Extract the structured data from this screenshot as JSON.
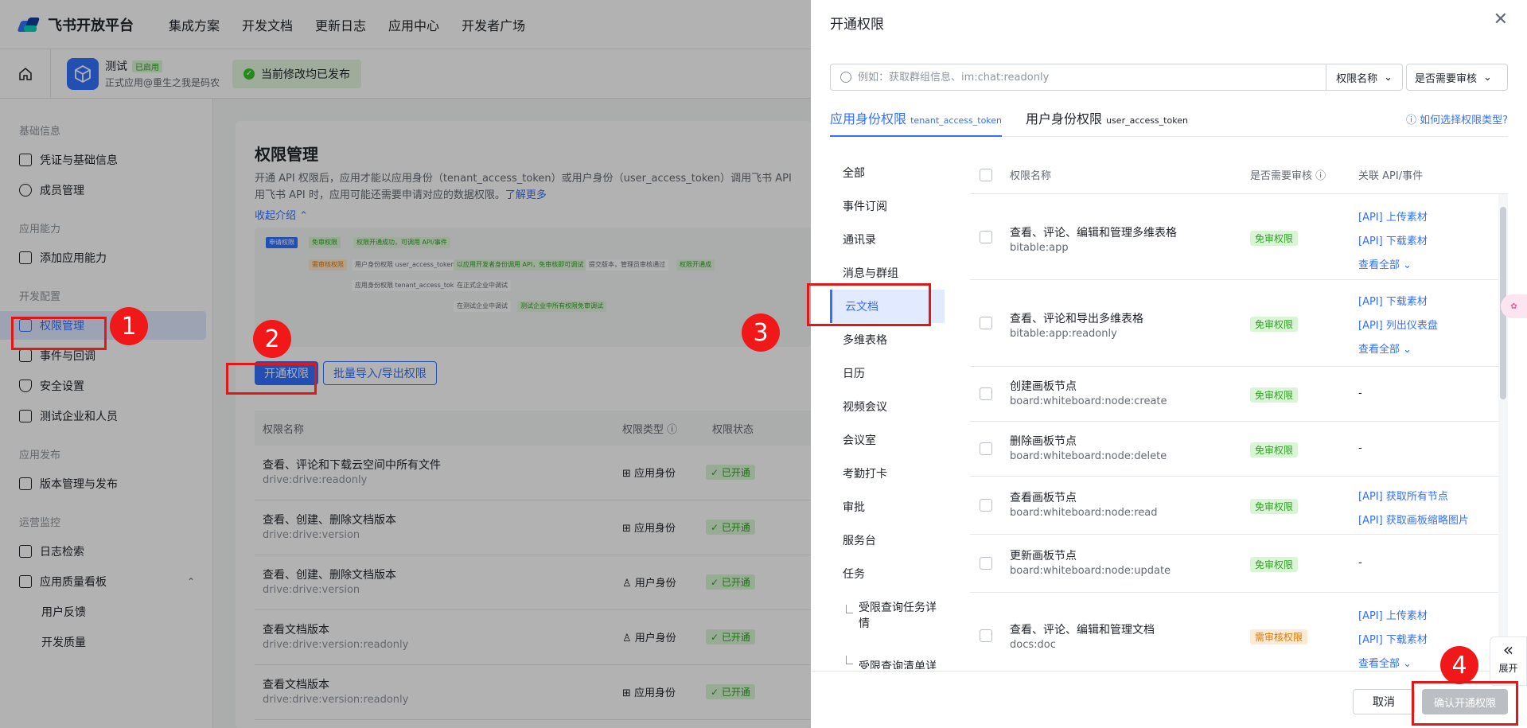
{
  "topnav": {
    "logo": "飞书开放平台",
    "links": [
      "集成方案",
      "开发文档",
      "更新日志",
      "应用中心",
      "开发者广场"
    ]
  },
  "appbar": {
    "app_name": "测试",
    "app_tag": "已启用",
    "app_sub": "正式应用@重生之我是码农",
    "publish_status": "当前修改均已发布"
  },
  "sidebar": {
    "groups": [
      {
        "title": "基础信息",
        "items": [
          "凭证与基础信息",
          "成员管理"
        ]
      },
      {
        "title": "应用能力",
        "items": [
          "添加应用能力"
        ]
      },
      {
        "title": "开发配置",
        "items": [
          "权限管理",
          "事件与回调",
          "安全设置",
          "测试企业和人员"
        ]
      },
      {
        "title": "应用发布",
        "items": [
          "版本管理与发布"
        ]
      },
      {
        "title": "运营监控",
        "items": [
          "日志检索",
          "应用质量看板",
          "用户反馈",
          "开发质量"
        ]
      }
    ]
  },
  "main": {
    "title": "权限管理",
    "desc_line1": "开通 API 权限后，应用才能以应用身份（tenant_access_token）或用户身份（user_access_token）调用飞书 API",
    "desc_line2": "用飞书 API 时，应用可能还需要申请对应的数据权限。",
    "learn_more": "了解更多",
    "collapse": "收起介绍 ⌃",
    "flow": {
      "apply": "申请权限",
      "free": "免审权限",
      "free_result": "权限开通成功，可调用 API/事件",
      "review": "需审核权限",
      "user_identity": "用户身份权限",
      "user_token": "user_access_token 调用",
      "user_result": "以应用开发者身份调用 API，免审核即可调试",
      "submit": "提交版本，管理员审核通过",
      "final": "权限开通成",
      "app_identity": "应用身份权限",
      "app_token": "tenant_access_token 调用",
      "prod": "在正式企业中调试",
      "test": "在测试企业中调试",
      "test_result": "测试企业中所有权限免审调试"
    },
    "btn_open": "开通权限",
    "btn_batch": "批量导入/导出权限",
    "table_headers": [
      "权限名称",
      "权限类型",
      "权限状态"
    ],
    "rows": [
      {
        "name": "查看、评论和下载云空间中所有文件",
        "code": "drive:drive:readonly",
        "type": "应用身份",
        "status": "已开通"
      },
      {
        "name": "查看、创建、删除文档版本",
        "code": "drive:drive:version",
        "type": "应用身份",
        "status": "已开通"
      },
      {
        "name": "查看、创建、删除文档版本",
        "code": "drive:drive:version",
        "type": "用户身份",
        "status": "已开通"
      },
      {
        "name": "查看文档版本",
        "code": "drive:drive:version:readonly",
        "type": "用户身份",
        "status": "已开通"
      },
      {
        "name": "查看文档版本",
        "code": "drive:drive:version:readonly",
        "type": "应用身份",
        "status": "已开通"
      }
    ]
  },
  "drawer": {
    "title": "开通权限",
    "search_placeholder": "例如：获取群组信息、im:chat:readonly",
    "filter_name": "权限名称",
    "filter_review": "是否需要审核",
    "tab_app": "应用身份权限",
    "tab_app_token": "tenant_access_token",
    "tab_user": "用户身份权限",
    "tab_user_token": "user_access_token",
    "help_link": "如何选择权限类型?",
    "categories": [
      "全部",
      "事件订阅",
      "通讯录",
      "消息与群组",
      "云文档",
      "多维表格",
      "日历",
      "视频会议",
      "会议室",
      "考勤打卡",
      "审批",
      "服务台",
      "任务"
    ],
    "subcategories": [
      "受限查询任务详情",
      "受限查询清单详"
    ],
    "headers": [
      "权限名称",
      "是否需要审核",
      "关联 API/事件"
    ],
    "perms": [
      {
        "name": "查看、评论、编辑和管理多维表格",
        "code": "bitable:app",
        "badge": "免审权限",
        "apis": [
          "[API] 上传素材",
          "[API] 下载素材",
          "查看全部"
        ]
      },
      {
        "name": "查看、评论和导出多维表格",
        "code": "bitable:app:readonly",
        "badge": "免审权限",
        "apis": [
          "[API] 下载素材",
          "[API] 列出仪表盘",
          "查看全部"
        ]
      },
      {
        "name": "创建画板节点",
        "code": "board:whiteboard:node:create",
        "badge": "免审权限",
        "apis": []
      },
      {
        "name": "删除画板节点",
        "code": "board:whiteboard:node:delete",
        "badge": "免审权限",
        "apis": []
      },
      {
        "name": "查看画板节点",
        "code": "board:whiteboard:node:read",
        "badge": "免审权限",
        "apis": [
          "[API] 获取所有节点",
          "[API] 获取画板缩略图片"
        ]
      },
      {
        "name": "更新画板节点",
        "code": "board:whiteboard:node:update",
        "badge": "免审权限",
        "apis": []
      },
      {
        "name": "查看、评论、编辑和管理文档",
        "code": "docs:doc",
        "badge": "需审核权限",
        "apis": [
          "[API] 上传素材",
          "[API] 下载素材",
          "查看全部"
        ]
      }
    ],
    "dash": "-",
    "cancel": "取消",
    "confirm": "确认开通权限",
    "expand": "展开"
  },
  "annotations": [
    "1",
    "2",
    "3",
    "4"
  ],
  "colors": {
    "accent": "#3370ff",
    "annotation": "#f01818",
    "success": "#2ea121"
  }
}
